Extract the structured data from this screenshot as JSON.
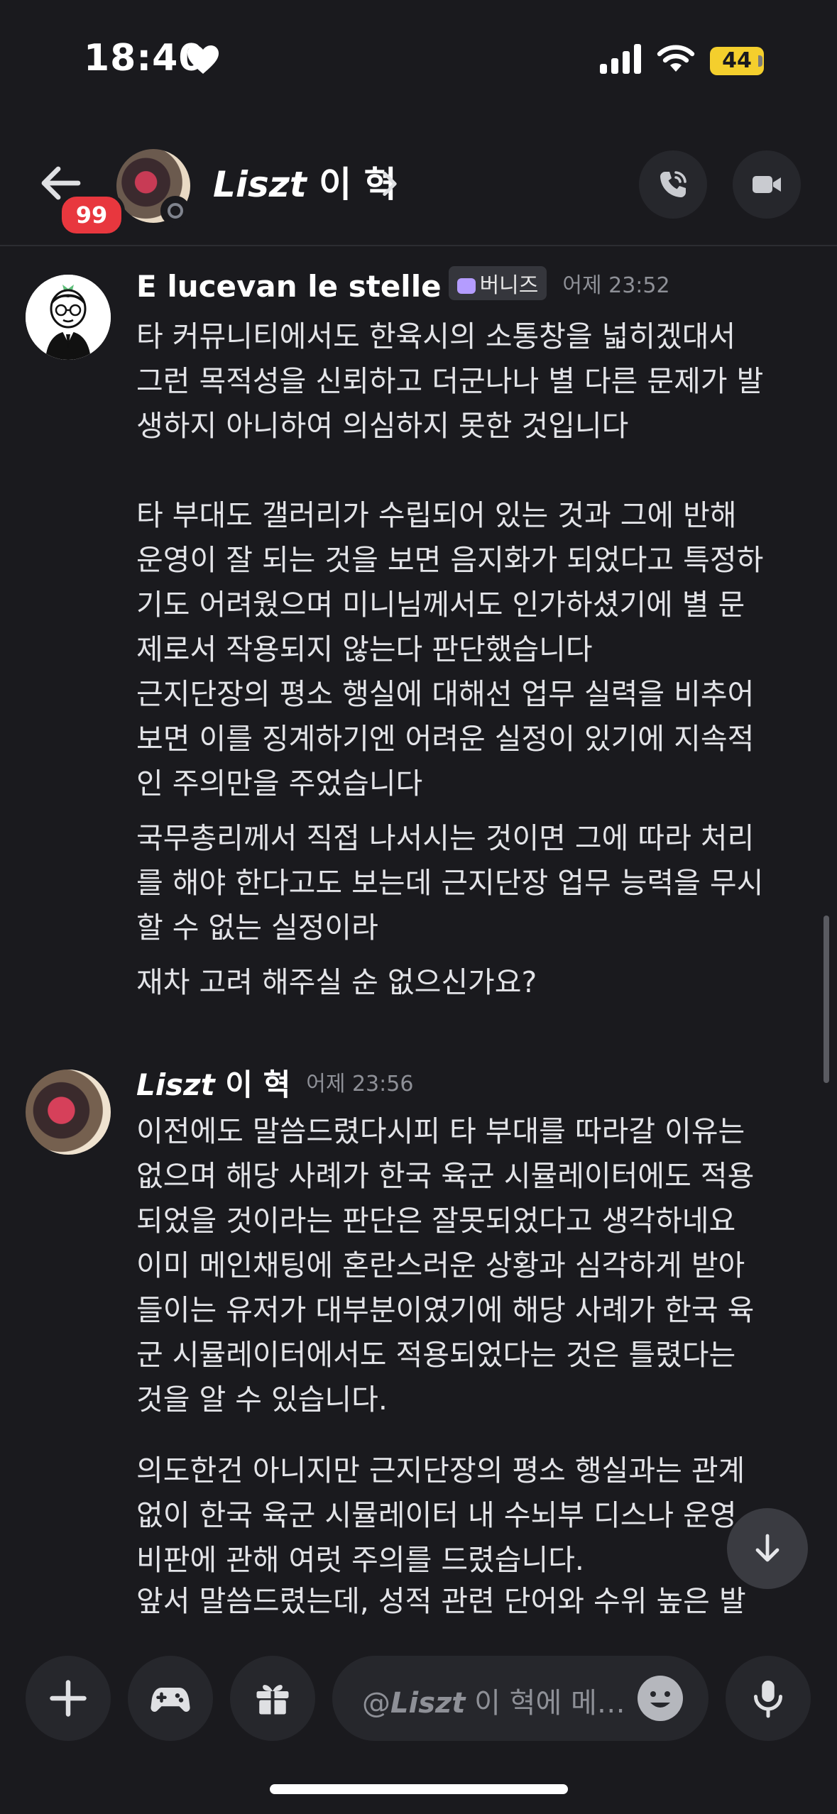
{
  "status_bar": {
    "time": "18:40",
    "battery": "44"
  },
  "header": {
    "unread_badge": "99",
    "channel_name_italic": "Liszt",
    "channel_name_rest": " 이 혁"
  },
  "messages": [
    {
      "author": "E lucevan le stelle",
      "role_tag": "버니즈",
      "timestamp": "어제 23:52",
      "paragraphs": [
        "타 커뮤니티에서도 한육시의 소통창을 넓히겠대서\n그런 목적성을 신뢰하고 더군나나 별 다른 문제가 발\n생하지 아니하여 의심하지 못한 것입니다\n\n타 부대도 갤러리가 수립되어 있는 것과 그에 반해\n운영이 잘 되는 것을 보면 음지화가 되었다고 특정하\n기도 어려웠으며 미니님께서도 인가하셨기에 별 문\n제로서 작용되지 않는다 판단했습니다",
        "근지단장의 평소 행실에 대해선 업무 실력을 비추어\n보면 이를 징계하기엔 어려운 실정이 있기에 지속적\n인 주의만을 주었습니다",
        "국무총리께서 직접 나서시는 것이면 그에 따라 처리\n를 해야 한다고도 보는데 근지단장 업무 능력을 무시\n할 수 없는 실정이라",
        "재차 고려 해주실 순 없으신가요?"
      ]
    },
    {
      "author_italic": "Liszt",
      "author_rest": " 이 혁",
      "timestamp": "어제 23:56",
      "paragraphs": [
        "이전에도 말씀드렸다시피 타 부대를 따라갈 이유는\n없으며 해당 사례가 한국 육군 시뮬레이터에도 적용\n되었을 것이라는 판단은 잘못되었다고 생각하네요\n이미 메인채팅에 혼란스러운 상황과 심각하게 받아\n들이는 유저가 대부분이였기에 해당 사례가 한국 육\n군 시뮬레이터에서도 적용되었다는 것은 틀렸다는\n것을 알 수 있습니다.",
        "의도한건 아니지만 근지단장의 평소 행실과는 관계\n없이 한국 육군 시뮬레이터 내 수뇌부 디스나 운영\n비판에 관해 여럿 주의를 드렸습니다.",
        "앞서 말씀드렸는데, 성적 관련 단어와 수위 높은 발"
      ]
    }
  ],
  "composer": {
    "placeholder_prefix": "@",
    "placeholder_italic": "Liszt",
    "placeholder_rest": " 이 혁에 메…"
  },
  "icons": [
    "heart-icon",
    "signal-icon",
    "wifi-icon",
    "battery-icon",
    "back-arrow-icon",
    "chevron-right-icon",
    "phone-call-icon",
    "video-camera-icon",
    "arrow-down-icon",
    "plus-icon",
    "gamepad-icon",
    "gift-icon",
    "emoji-icon",
    "microphone-icon"
  ],
  "colors": {
    "background": "#1a1a1e",
    "badge": "#e8373e",
    "battery": "#f4cf2d",
    "role_gem": "#b49cff"
  }
}
